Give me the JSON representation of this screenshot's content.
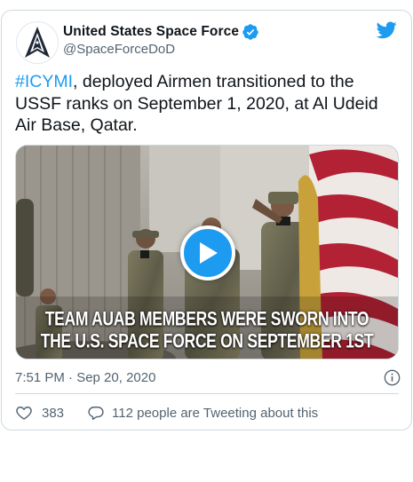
{
  "account": {
    "display_name": "United States Space Force",
    "handle": "@SpaceForceDoD",
    "verified": true,
    "avatar_icon": "delta-emblem-icon"
  },
  "platform_icon": "twitter-bird-icon",
  "tweet": {
    "hashtag": "#ICYMI",
    "text": ", deployed Airmen transitioned to the USSF ranks on September 1, 2020, at Al Udeid Air Base, Qatar.",
    "timestamp": "7:51 PM · Sep 20, 2020"
  },
  "media": {
    "type": "video",
    "caption_line_1": "TEAM AUAB MEMBERS WERE SWORN INTO",
    "caption_line_2": "THE U.S. SPACE FORCE ON SEPTEMBER 1ST",
    "play_icon": "play-icon"
  },
  "engagement": {
    "likes": "383",
    "reply_text": "112 people are Tweeting about this",
    "like_icon": "heart-icon",
    "reply_icon": "reply-bubble-icon",
    "info_icon": "info-icon"
  },
  "colors": {
    "accent": "#1d9bf0",
    "text_primary": "#0f1419",
    "text_secondary": "#536471",
    "border": "#cfd9de"
  }
}
